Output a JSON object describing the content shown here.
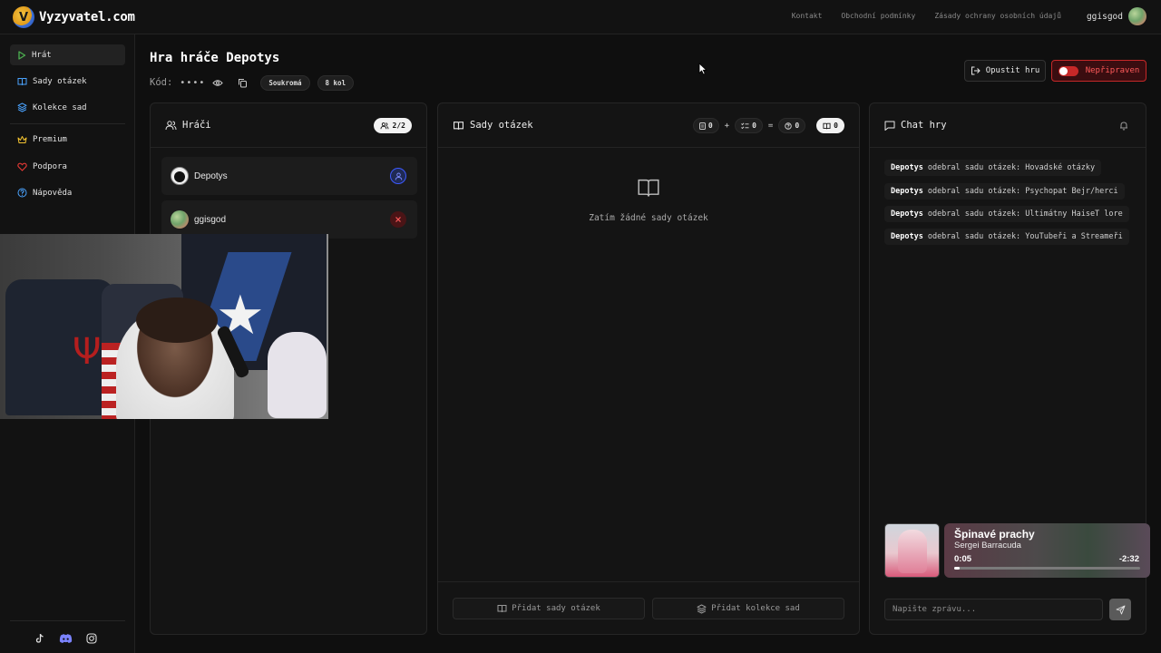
{
  "app": {
    "name": "Vyzyvatel.com",
    "logo_glyph": "V"
  },
  "top_links": [
    "Kontakt",
    "Obchodní podmínky",
    "Zásady ochrany osobních údajů"
  ],
  "user": {
    "name": "ggisgod"
  },
  "sidebar": {
    "items": [
      {
        "label": "Hrát",
        "icon": "play-icon",
        "color": "#4caf50",
        "active": true
      },
      {
        "label": "Sady otázek",
        "icon": "book-icon",
        "color": "#4aa3ff",
        "active": false
      },
      {
        "label": "Kolekce sad",
        "icon": "layers-icon",
        "color": "#4aa3ff",
        "active": false
      },
      {
        "label": "Premium",
        "icon": "crown-icon",
        "color": "#f2c230",
        "active": false
      },
      {
        "label": "Podpora",
        "icon": "heart-icon",
        "color": "#e53935",
        "active": false
      },
      {
        "label": "Nápověda",
        "icon": "help-icon",
        "color": "#4aa3ff",
        "active": false
      }
    ],
    "social": [
      "tiktok-icon",
      "discord-icon",
      "instagram-icon"
    ]
  },
  "game": {
    "title": "Hra hráče Depotys",
    "code_label": "Kód:",
    "code_masked": "••••",
    "visibility": "Soukromá",
    "rounds": "8 kol"
  },
  "actions": {
    "leave": "Opustit hru",
    "ready": "Nepřipraven"
  },
  "players_panel": {
    "title": "Hráči",
    "count": "2/2",
    "players": [
      {
        "name": "Depotys",
        "role_icon": "user-icon",
        "role_color": "#3d5afe"
      },
      {
        "name": "ggisgod",
        "role_icon": "close-icon",
        "role_color": "#e53935"
      }
    ]
  },
  "sets_panel": {
    "title": "Sady otázek",
    "stats": {
      "a": "0",
      "plus": "+",
      "b": "0",
      "equals": "=",
      "c": "0",
      "total": "0"
    },
    "empty_text": "Zatím žádné sady otázek",
    "add_sets": "Přidat sady otázek",
    "add_collections": "Přidat kolekce sad"
  },
  "chat": {
    "title": "Chat hry",
    "messages": [
      {
        "user": "Depotys",
        "text": "odebral sadu otázek: Hovadské otázky"
      },
      {
        "user": "Depotys",
        "text": "odebral sadu otázek: Psychopat Bejr/herci"
      },
      {
        "user": "Depotys",
        "text": "odebral sadu otázek: Ultimátny HaiseT lore"
      },
      {
        "user": "Depotys",
        "text": "odebral sadu otázek: YouTubeři a Streameři"
      }
    ],
    "placeholder": "Napište zprávu..."
  },
  "music": {
    "title": "Špinavé prachy",
    "artist": "Sergei Barracuda",
    "elapsed": "0:05",
    "remaining": "-2:32",
    "progress": 0.03
  }
}
